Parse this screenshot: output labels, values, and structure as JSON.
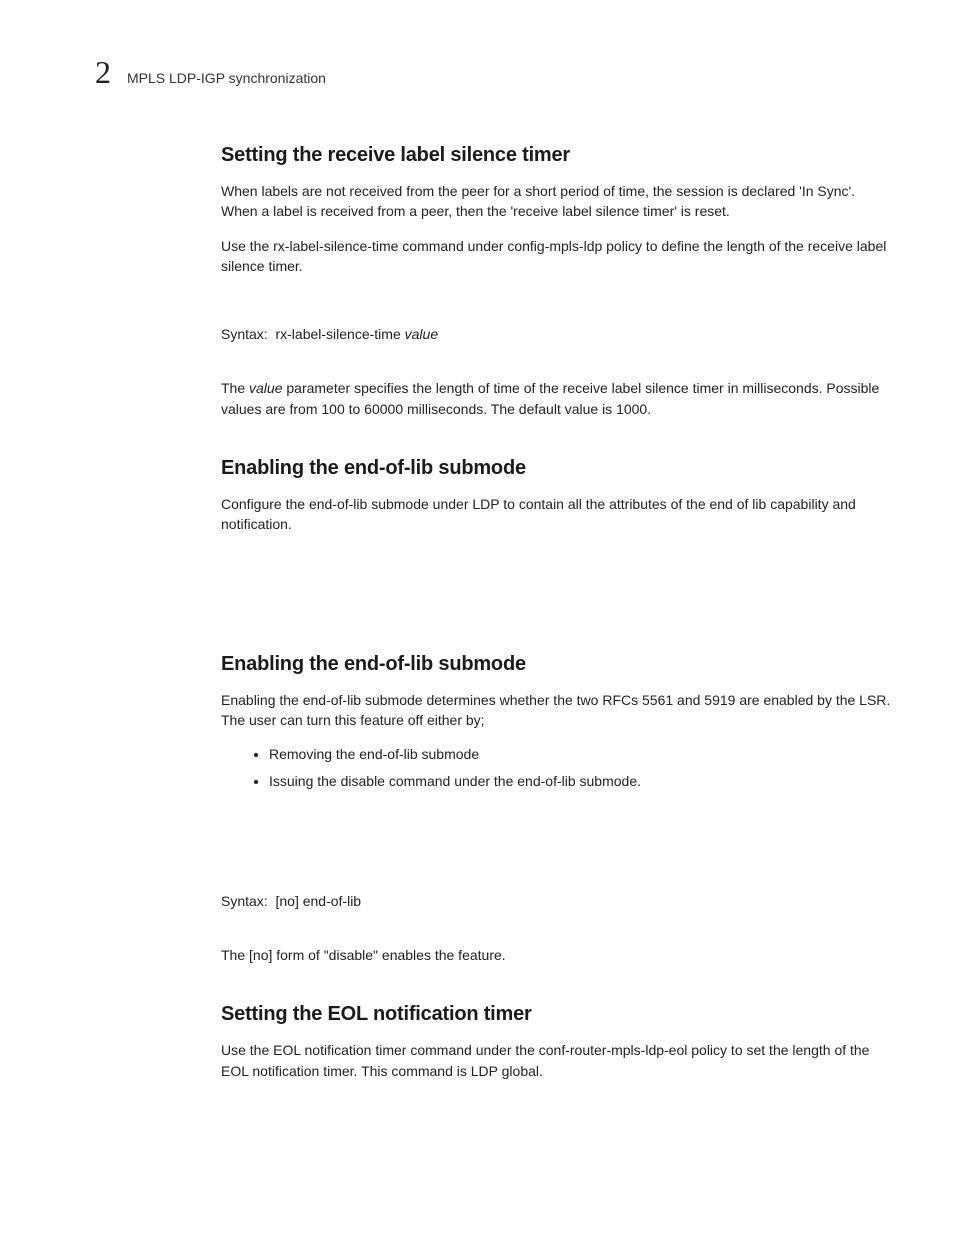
{
  "header": {
    "chapter_number": "2",
    "running_title": "MPLS LDP-IGP synchronization"
  },
  "section1": {
    "heading": "Setting the receive label silence timer",
    "p1": "When labels are not received from the peer for a short period of time, the session is declared 'In Sync'. When a label is received from a peer, then the 'receive label silence timer' is reset.",
    "p2": "Use the rx-label-silence-time command under config-mpls-ldp policy to define the length of the receive label silence timer.",
    "syntax_label": "Syntax:",
    "syntax_cmd": "rx-label-silence-time",
    "syntax_param": "value",
    "p3a": "The ",
    "p3b": "value",
    "p3c": " parameter specifies the length of time of the receive label silence timer in milliseconds. Possible values are from 100 to 60000 milliseconds. The default value is 1000."
  },
  "section2": {
    "heading": "Enabling the end-of-lib submode",
    "p1": "Configure the end-of-lib submode under LDP to contain all the attributes of the end of lib capability and notification."
  },
  "section3": {
    "heading": "Enabling the end-of-lib submode",
    "p1": "Enabling the end-of-lib submode determines whether the two RFCs 5561 and 5919 are enabled by the LSR. The user can turn this feature off either by;",
    "bullet1": "Removing the end-of-lib submode",
    "bullet2": "Issuing the disable command under the end-of-lib submode.",
    "syntax_label": "Syntax:",
    "syntax_cmd": "[no] end-of-lib",
    "p2": "The [no] form of \"disable\" enables the feature."
  },
  "section4": {
    "heading": "Setting the EOL notification timer",
    "p1": "Use the EOL notification timer command under the conf-router-mpls-ldp-eol policy to set the length of the EOL notification timer. This command is LDP global."
  }
}
